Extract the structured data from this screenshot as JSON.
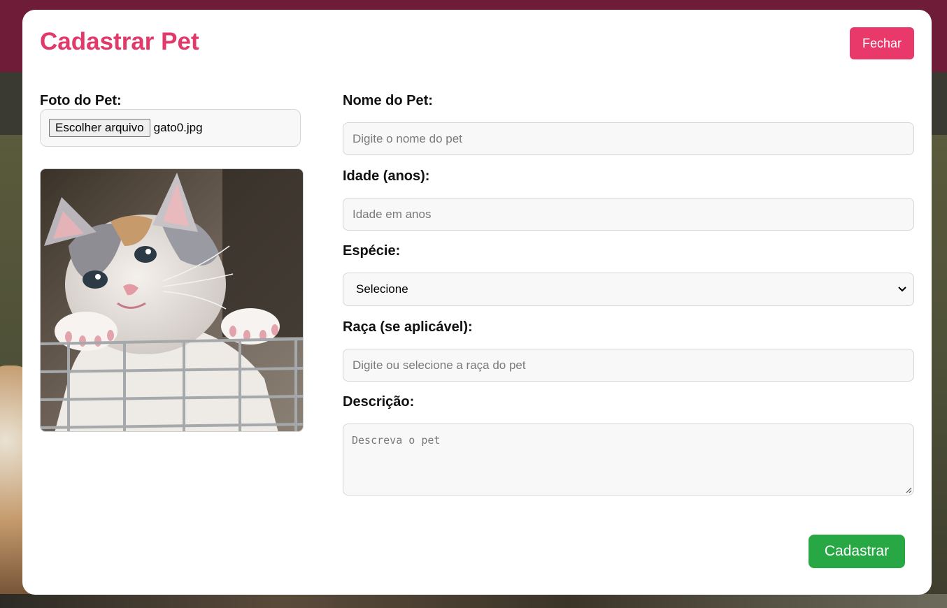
{
  "modal": {
    "title": "Cadastrar Pet",
    "close_label": "Fechar",
    "submit_label": "Cadastrar"
  },
  "photo": {
    "label": "Foto do Pet:",
    "choose_file_label": "Escolher arquivo",
    "file_name": "gato0.jpg",
    "preview_alt": "kitten-photo"
  },
  "form": {
    "name": {
      "label": "Nome do Pet:",
      "placeholder": "Digite o nome do pet",
      "value": ""
    },
    "age": {
      "label": "Idade (anos):",
      "placeholder": "Idade em anos",
      "value": ""
    },
    "species": {
      "label": "Espécie:",
      "selected": "Selecione"
    },
    "breed": {
      "label": "Raça (se aplicável):",
      "placeholder": "Digite ou selecione a raça do pet",
      "value": ""
    },
    "description": {
      "label": "Descrição:",
      "placeholder": "Descreva o pet",
      "value": ""
    }
  },
  "colors": {
    "title": "#e0396a",
    "close_button": "#e8396a",
    "submit_button": "#28a745",
    "background_header": "#6e1c38"
  }
}
